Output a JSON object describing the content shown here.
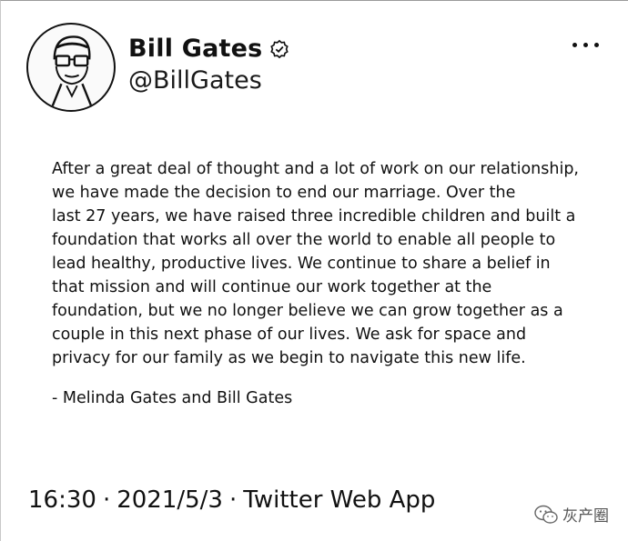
{
  "user": {
    "name": "Bill Gates",
    "handle": "@BillGates",
    "verified": true
  },
  "tweet": {
    "lines": [
      "After a great deal of thought and a lot of work on our relationship,",
      "we have made the decision to end our marriage. Over the",
      "last 27 years, we have raised three incredible children and built a",
      "foundation that works all over the world to enable all people to",
      "lead healthy, productive lives. We continue to share a belief in",
      "that mission and will continue our work together at the",
      "foundation, but we no longer believe we can grow together as a",
      "couple in this next phase of our lives. We ask for space and",
      "privacy for our family as we begin to navigate this new life."
    ],
    "signature": "- Melinda Gates and Bill Gates"
  },
  "meta": {
    "time": "16:30",
    "separator": "·",
    "date": "2021/5/3",
    "source": "Twitter Web App"
  },
  "watermark": {
    "text": "灰产圈",
    "icon": "wechat-icon"
  }
}
